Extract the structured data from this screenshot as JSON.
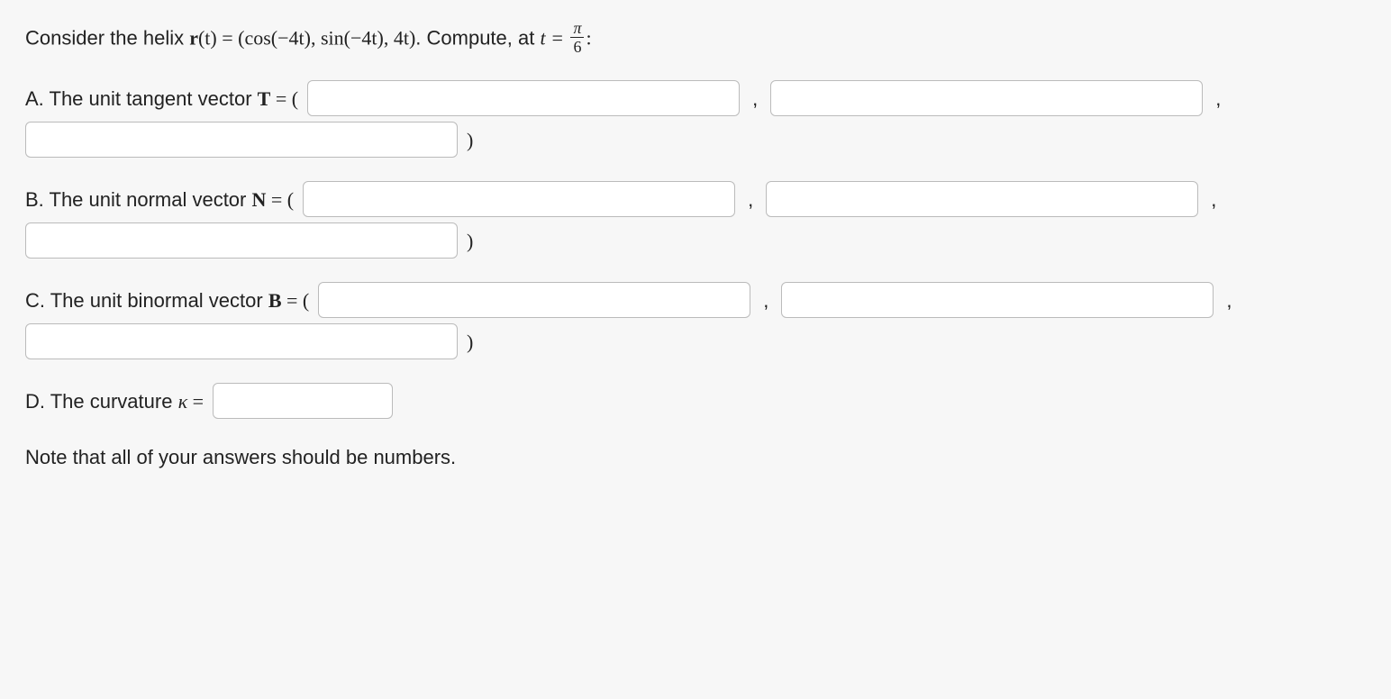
{
  "intro": {
    "prefix": "Consider the helix ",
    "r": "r",
    "t_paren": "(t) = (",
    "cos": "cos(−4t), sin(−4t), 4t",
    "close_paren": ")",
    "compute": ". Compute, at ",
    "t_eq": "t = ",
    "frac_num": "π",
    "frac_den": "6",
    "colon": ":"
  },
  "partA": {
    "label": "A. The unit tangent vector ",
    "symbol": "T",
    "equals_open": " = (",
    "comma": ",",
    "close": ")"
  },
  "partB": {
    "label": "B. The unit normal vector ",
    "symbol": "N",
    "equals_open": " = (",
    "comma": ",",
    "close": ")"
  },
  "partC": {
    "label": "C. The unit binormal vector ",
    "symbol": "B",
    "equals_open": " = (",
    "comma": ",",
    "close": ")"
  },
  "partD": {
    "label": "D. The curvature ",
    "symbol": "κ",
    "equals": " = "
  },
  "note": "Note that all of your answers should be numbers."
}
